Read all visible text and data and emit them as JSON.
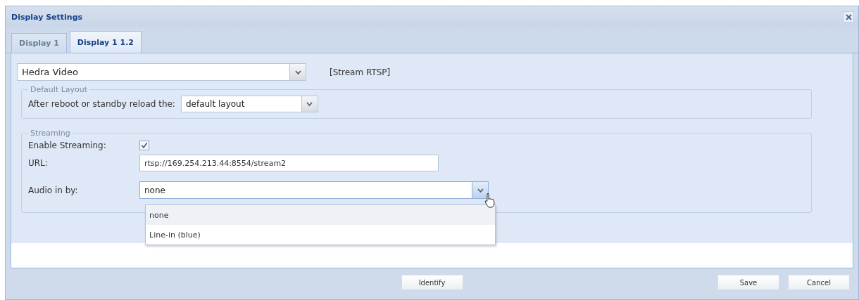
{
  "window": {
    "title": "Display Settings"
  },
  "tabs": [
    {
      "label": "Display 1",
      "selected": false
    },
    {
      "label": "Display 1 1.2",
      "selected": true
    }
  ],
  "source": {
    "value": "Hedra Video",
    "note": "[Stream RTSP]"
  },
  "default_layout": {
    "legend": "Default Layout",
    "label": "After reboot or standby reload the:",
    "value": "default layout"
  },
  "streaming": {
    "legend": "Streaming",
    "enable_label": "Enable Streaming:",
    "enabled": true,
    "url_label": "URL:",
    "url": "rtsp://169.254.213.44:8554/stream2",
    "audio_label": "Audio in by:",
    "audio_value": "none",
    "audio_expanded": true,
    "audio_options": [
      {
        "label": "none",
        "selected": true
      },
      {
        "label": "Line-in (blue)",
        "selected": false
      }
    ]
  },
  "footer": {
    "center_button": "Identify",
    "buttons": [
      "Save",
      "Cancel"
    ]
  }
}
